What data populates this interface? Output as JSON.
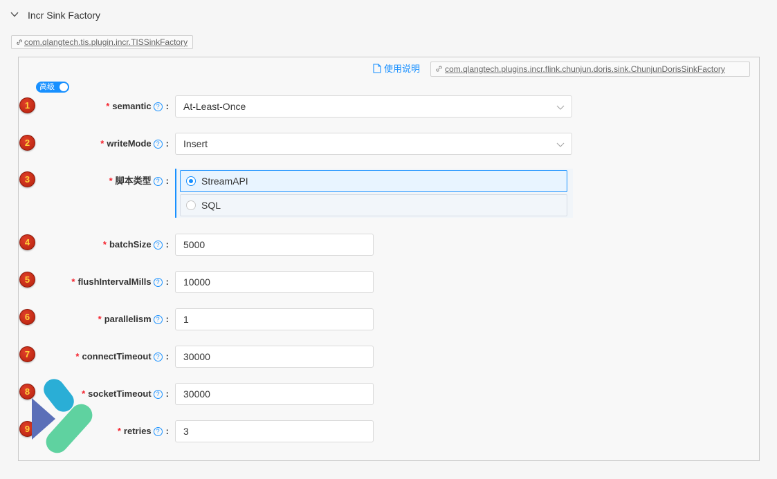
{
  "section": {
    "title": "Incr Sink Factory",
    "class_tag": "com.qlangtech.tis.plugin.incr.TISSinkFactory"
  },
  "panel": {
    "doc_link": "使用说明",
    "impl_tag": "com.qlangtech.plugins.incr.flink.chunjun.doris.sink.ChunjunDorisSinkFactory",
    "advanced_toggle": {
      "label": "高级",
      "on": true
    }
  },
  "fields": {
    "semantic": {
      "badge": "1",
      "label": "semantic",
      "value": "At-Least-Once"
    },
    "writeMode": {
      "badge": "2",
      "label": "writeMode",
      "value": "Insert"
    },
    "scriptType": {
      "badge": "3",
      "label": "脚本类型",
      "options": [
        "StreamAPI",
        "SQL"
      ],
      "selected": "StreamAPI"
    },
    "batchSize": {
      "badge": "4",
      "label": "batchSize",
      "value": "5000"
    },
    "flushIntervalMills": {
      "badge": "5",
      "label": "flushIntervalMills",
      "value": "10000"
    },
    "parallelism": {
      "badge": "6",
      "label": "parallelism",
      "value": "1"
    },
    "connectTimeout": {
      "badge": "7",
      "label": "connectTimeout",
      "value": "30000"
    },
    "socketTimeout": {
      "badge": "8",
      "label": "socketTimeout",
      "value": "30000"
    },
    "retries": {
      "badge": "9",
      "label": "retries",
      "value": "3"
    }
  },
  "common": {
    "required_mark": "*",
    "help_glyph": "?",
    "colon": ":"
  },
  "colors": {
    "accent": "#1890ff",
    "required": "#f5222d",
    "badge": "#c92a12"
  },
  "icons": [
    "chevron-down-icon",
    "link-icon",
    "document-icon",
    "help-icon",
    "select-arrow-icon",
    "logo-icon"
  ]
}
